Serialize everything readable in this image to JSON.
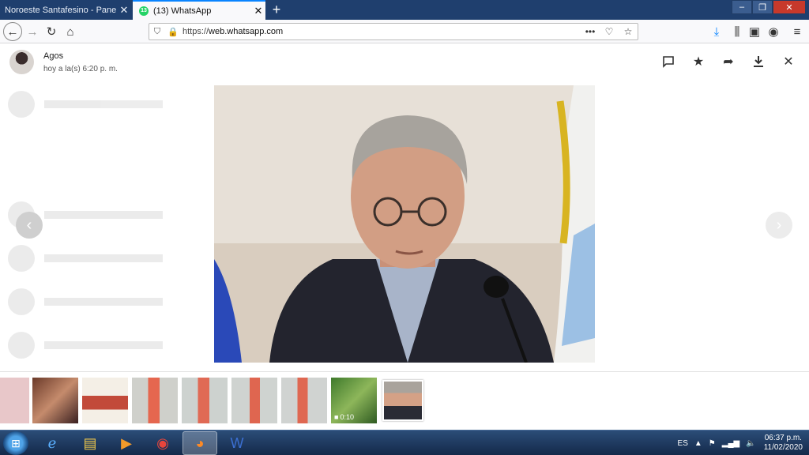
{
  "browser": {
    "tabs": [
      {
        "title": "Noroeste Santafesino - Panel de Ad",
        "active": false
      },
      {
        "title": "(13) WhatsApp",
        "active": true,
        "badge": "13"
      }
    ],
    "url": {
      "scheme": "https://",
      "host": "web.whatsapp.com"
    }
  },
  "viewer": {
    "sender_name": "Agos",
    "sender_time": "hoy a la(s) 6:20 p. m.",
    "actions": [
      "message-icon",
      "star-icon",
      "forward-icon",
      "download-icon",
      "close-icon"
    ],
    "video_duration": "0:10"
  },
  "taskbar": {
    "language": "ES",
    "time": "06:37 p.m.",
    "date": "11/02/2020"
  },
  "colors": {
    "titlebar": "#1f3f6e",
    "accent": "#0a84ff",
    "whatsapp_green": "#25d366"
  }
}
